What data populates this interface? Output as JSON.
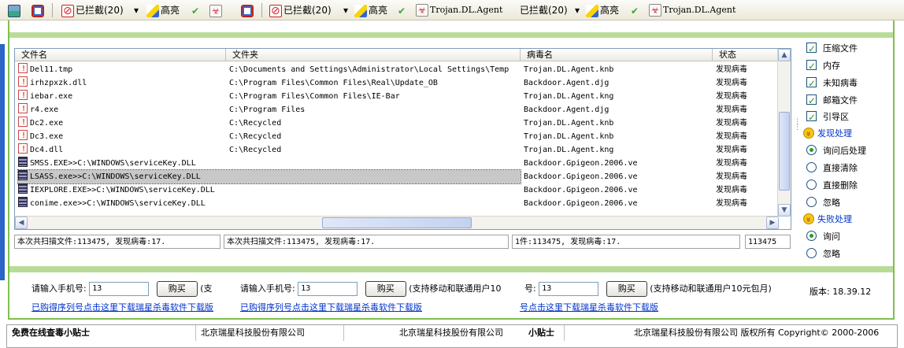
{
  "toolbar": {
    "blocked_label": "已拦截(20)",
    "highlight_label": "高亮",
    "virus_name": "Trojan.DL.Agent"
  },
  "table": {
    "headers": [
      "文件名",
      "文件夹",
      "病毒名",
      "状态"
    ],
    "rows": [
      {
        "file": "Del11.tmp",
        "folder": "C:\\Documents and Settings\\Administrator\\Local Settings\\Temp",
        "virus": "Trojan.DL.Agent.knb",
        "status": "发现病毒",
        "icon": "warning-file-icon"
      },
      {
        "file": "irhzpxzk.dll",
        "folder": "C:\\Program Files\\Common Files\\Real\\Update_OB",
        "virus": "Backdoor.Agent.djg",
        "status": "发现病毒",
        "icon": "warning-file-icon"
      },
      {
        "file": "iebar.exe",
        "folder": "C:\\Program Files\\Common Files\\IE-Bar",
        "virus": "Trojan.DL.Agent.kng",
        "status": "发现病毒",
        "icon": "warning-file-icon"
      },
      {
        "file": "r4.exe",
        "folder": "C:\\Program Files",
        "virus": "Backdoor.Agent.djg",
        "status": "发现病毒",
        "icon": "warning-file-icon"
      },
      {
        "file": "Dc2.exe",
        "folder": "C:\\Recycled",
        "virus": "Trojan.DL.Agent.knb",
        "status": "发现病毒",
        "icon": "warning-file-icon"
      },
      {
        "file": "Dc3.exe",
        "folder": "C:\\Recycled",
        "virus": "Trojan.DL.Agent.knb",
        "status": "发现病毒",
        "icon": "warning-file-icon"
      },
      {
        "file": "Dc4.dll",
        "folder": "C:\\Recycled",
        "virus": "Trojan.DL.Agent.kng",
        "status": "发现病毒",
        "icon": "warning-file-icon"
      },
      {
        "file": "SMSS.EXE>>C:\\WINDOWS\\serviceKey.DLL",
        "folder": "",
        "virus": "Backdoor.Gpigeon.2006.ve",
        "status": "发现病毒",
        "icon": "process-icon"
      },
      {
        "file": "LSASS.exe>>C:\\WINDOWS\\serviceKey.DLL",
        "folder": "",
        "virus": "Backdoor.Gpigeon.2006.ve",
        "status": "发现病毒",
        "icon": "process-icon",
        "selected": true
      },
      {
        "file": "IEXPLORE.EXE>>C:\\WINDOWS\\serviceKey.DLL",
        "folder": "",
        "virus": "Backdoor.Gpigeon.2006.ve",
        "status": "发现病毒",
        "icon": "process-icon"
      },
      {
        "file": "conime.exe>>C:\\WINDOWS\\serviceKey.DLL",
        "folder": "",
        "virus": "Backdoor.Gpigeon.2006.ve",
        "status": "发现病毒",
        "icon": "process-icon"
      }
    ]
  },
  "status": {
    "summary_full": "本次共扫描文件:113475, 发现病毒:17.",
    "summary_tail": "1件:113475, 发现病毒:17.",
    "count": "113475"
  },
  "options": {
    "scan_targets": [
      {
        "label": "压缩文件",
        "checked": true
      },
      {
        "label": "内存",
        "checked": true
      },
      {
        "label": "未知病毒",
        "checked": true
      },
      {
        "label": "邮箱文件",
        "checked": true
      },
      {
        "label": "引导区",
        "checked": true
      }
    ],
    "found_group": "发现处理",
    "found_actions": [
      {
        "label": "询问后处理",
        "selected": true
      },
      {
        "label": "直接清除",
        "selected": false
      },
      {
        "label": "直接删除",
        "selected": false
      },
      {
        "label": "忽略",
        "selected": false
      }
    ],
    "fail_group": "失败处理",
    "fail_actions": [
      {
        "label": "询问",
        "selected": true
      },
      {
        "label": "忽略",
        "selected": false
      }
    ]
  },
  "purchase": {
    "phone_prompt": "请输入手机号:",
    "phone_prompt_partial": "号:",
    "phone_value": "13",
    "buy_label": "购买",
    "support_partial": "(支",
    "support_text": "(支持移动和联通用户10",
    "support_text_full": "(支持移动和联通用户10元包月)",
    "download_link": "已购得序列号点击这里下载瑞星杀毒软件下载版",
    "download_link_partial": "号点击这里下载瑞星杀毒软件下载版",
    "version_label": "版本:",
    "version_value": "18.39.12"
  },
  "bottom": {
    "tip_title": "免费在线查毒小贴士",
    "company": "北京瑞星科技股份有限公司",
    "company_rights": "北京瑞星科技股份有限公司 版权所有",
    "copyright": "Copyright© 2000-2006",
    "tip_title_partial": "小贴士"
  }
}
